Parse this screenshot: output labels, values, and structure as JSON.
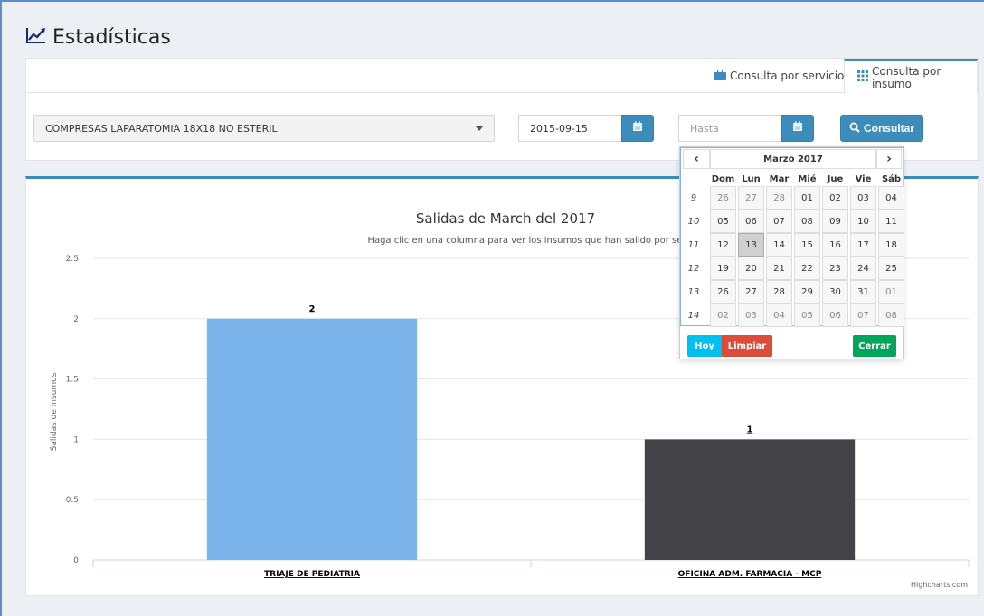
{
  "page": {
    "title": "Estadísticas"
  },
  "tabs": [
    {
      "label": "Consulta por servicio"
    },
    {
      "label": "Consulta por insumo"
    }
  ],
  "form": {
    "product_value": "COMPRESAS LAPARATOMIA 18X18 NO ESTERIL",
    "desde_value": "2015-09-15",
    "hasta_placeholder": "Hasta",
    "consultar_label": "Consultar"
  },
  "datepicker": {
    "month_label": "Marzo 2017",
    "prev": "‹",
    "next": "›",
    "dow": [
      "Dom",
      "Lun",
      "Mar",
      "Mié",
      "Jue",
      "Vie",
      "Sáb"
    ],
    "weeks": [
      {
        "num": "9",
        "days": [
          "26",
          "27",
          "28",
          "01",
          "02",
          "03",
          "04"
        ]
      },
      {
        "num": "10",
        "days": [
          "05",
          "06",
          "07",
          "08",
          "09",
          "10",
          "11"
        ]
      },
      {
        "num": "11",
        "days": [
          "12",
          "13",
          "14",
          "15",
          "16",
          "17",
          "18"
        ]
      },
      {
        "num": "12",
        "days": [
          "19",
          "20",
          "21",
          "22",
          "23",
          "24",
          "25"
        ]
      },
      {
        "num": "13",
        "days": [
          "26",
          "27",
          "28",
          "29",
          "30",
          "31",
          "01"
        ]
      },
      {
        "num": "14",
        "days": [
          "02",
          "03",
          "04",
          "05",
          "06",
          "07",
          "08"
        ]
      }
    ],
    "selected_day": "13",
    "btn_hoy": "Hoy",
    "btn_limpiar": "Limpiar",
    "btn_cerrar": "Cerrar",
    "colors": {
      "hoy": "#00c0ef",
      "limpiar": "#dd4b39",
      "cerrar": "#00a65a"
    }
  },
  "chart_data": {
    "type": "bar",
    "title": "Salidas de March del 2017",
    "subtitle": "Haga clic en una columna para ver los insumos que han salido por servicio",
    "ylabel": "Salidas de insumos",
    "ylim": [
      0,
      2.5
    ],
    "yticks": [
      "0",
      "0.5",
      "1",
      "1.5",
      "2",
      "2.5"
    ],
    "categories": [
      "TRIAJE DE PEDIATRIA",
      "OFICINA ADM. FARMACIA - MCP"
    ],
    "values": [
      2,
      1
    ],
    "data_labels": [
      "2",
      "1"
    ],
    "colors": [
      "#7cb5ec",
      "#434348"
    ],
    "credits": "Highcharts.com",
    "grid": true
  }
}
